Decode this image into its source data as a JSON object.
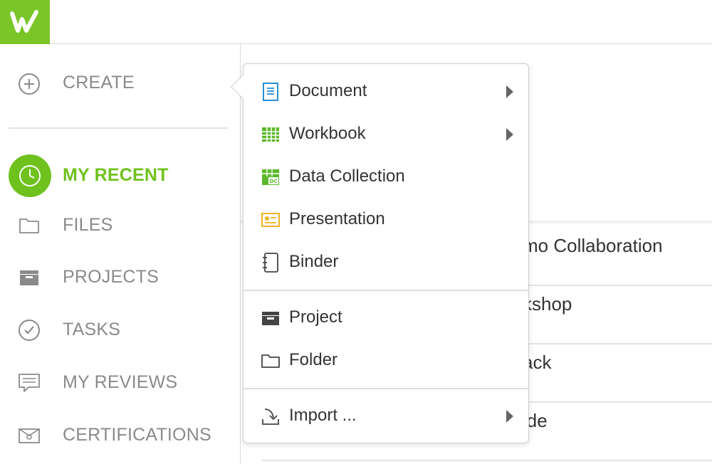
{
  "brand": {
    "logo_icon": "workiva-w-logo",
    "color": "#7ac527"
  },
  "sidebar": {
    "create_label": "CREATE",
    "items": [
      {
        "label": "MY RECENT",
        "icon": "clock-icon",
        "active": true
      },
      {
        "label": "FILES",
        "icon": "folder-icon"
      },
      {
        "label": "PROJECTS",
        "icon": "project-box-icon"
      },
      {
        "label": "TASKS",
        "icon": "check-circle-icon"
      },
      {
        "label": "MY REVIEWS",
        "icon": "comment-icon"
      },
      {
        "label": "CERTIFICATIONS",
        "icon": "certificate-icon"
      }
    ]
  },
  "content": {
    "rows": [
      {
        "partial_text": "mo Collaboration"
      },
      {
        "partial_text": "kshop"
      },
      {
        "partial_text": "ack"
      },
      {
        "partial_text": "ide"
      }
    ]
  },
  "create_menu": {
    "items": [
      {
        "label": "Document",
        "icon": "document-icon",
        "submenu": true
      },
      {
        "label": "Workbook",
        "icon": "workbook-icon",
        "submenu": true
      },
      {
        "label": "Data Collection",
        "icon": "data-collection-icon",
        "submenu": false
      },
      {
        "label": "Presentation",
        "icon": "presentation-icon",
        "submenu": false
      },
      {
        "label": "Binder",
        "icon": "binder-icon",
        "submenu": false
      },
      {
        "label": "Project",
        "icon": "project-box-icon",
        "submenu": false
      },
      {
        "label": "Folder",
        "icon": "folder-icon",
        "submenu": false
      },
      {
        "label": "Import ...",
        "icon": "import-icon",
        "submenu": true
      }
    ]
  },
  "colors": {
    "accent_green": "#6fc21e",
    "document_blue": "#2a8fd6",
    "workbook_green": "#5cb82a",
    "presentation_yellow": "#f0b321",
    "muted_text": "#8a8a8a"
  }
}
